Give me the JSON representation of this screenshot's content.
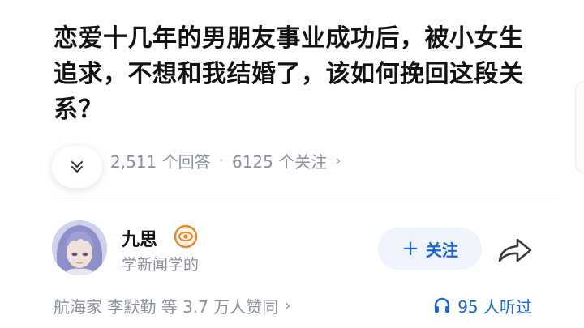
{
  "question": {
    "title": "恋爱十几年的男朋友事业成功后，被小女生追求，不想和我结婚了，该如何挽回这段关系？"
  },
  "meta": {
    "answers": "2,511 个回答",
    "separator": "·",
    "followers": "6125 个关注",
    "chevron": "›"
  },
  "expand": {
    "icon": "double-chevron-down-icon"
  },
  "author": {
    "name": "九思",
    "badge_icon": "eye-badge-icon",
    "bio": "学新闻学的"
  },
  "actions": {
    "follow_plus": "+",
    "follow_label": "关注",
    "share_icon": "share-arrow-icon"
  },
  "bottom": {
    "likes": "航海家 李默勤 等 3.7 万人赞同",
    "chevron": "›",
    "listen_icon": "headphones-icon",
    "listen_text": "95 人听过"
  },
  "colors": {
    "accent": "#1966d2",
    "muted": "#8a8f99",
    "follow_bg": "#eef3fc",
    "badge": "#e58a2c"
  }
}
